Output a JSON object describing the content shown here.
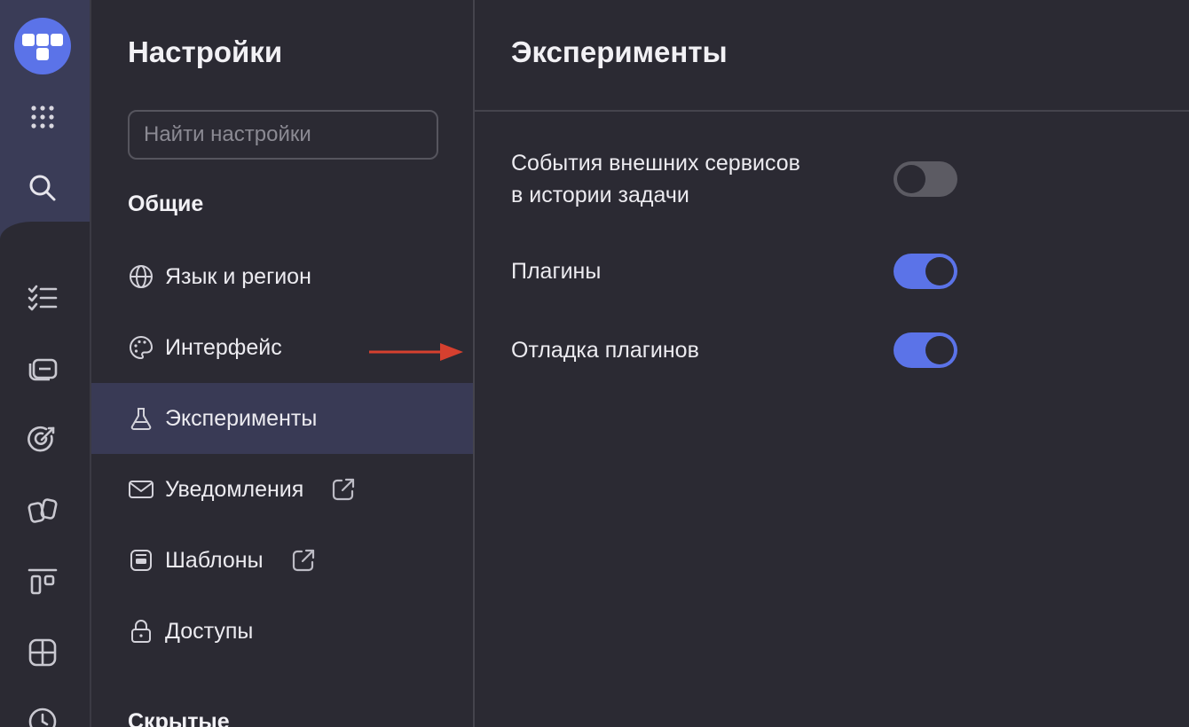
{
  "nav": {
    "title": "Настройки",
    "search_placeholder": "Найти настройки",
    "section_general": "Общие",
    "section_hidden": "Скрытые",
    "items": [
      {
        "label": "Язык и регион",
        "icon": "globe-icon"
      },
      {
        "label": "Интерфейс",
        "icon": "palette-icon"
      },
      {
        "label": "Эксперименты",
        "icon": "flask-icon",
        "active": true
      },
      {
        "label": "Уведомления",
        "icon": "mail-icon",
        "external": true
      },
      {
        "label": "Шаблоны",
        "icon": "template-icon",
        "external": true
      },
      {
        "label": "Доступы",
        "icon": "lock-icon"
      }
    ]
  },
  "main": {
    "title": "Эксперименты",
    "settings": [
      {
        "label_line1": "События внешних сервисов",
        "label_line2": "в истории задачи",
        "enabled": false
      },
      {
        "label": "Плагины",
        "enabled": true
      },
      {
        "label": "Отладка плагинов",
        "enabled": true
      }
    ]
  },
  "rail": {
    "icons": [
      "logo-icon",
      "apps-grid-icon",
      "search-icon",
      "checklist-icon",
      "folders-icon",
      "goals-icon",
      "projects-icon",
      "board-icon",
      "grid-icon",
      "clock-icon"
    ]
  },
  "colors": {
    "accent": "#5b73e8",
    "background": "#2b2a33",
    "active_nav": "#393a55",
    "annotation_arrow": "#d6402f"
  }
}
